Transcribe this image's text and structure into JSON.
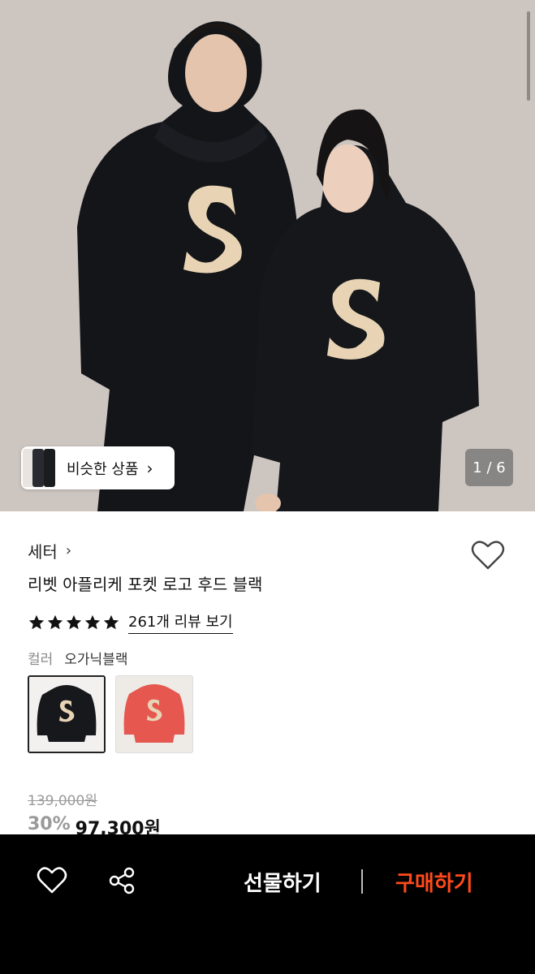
{
  "hero": {
    "similar_label": "비슷한 상품",
    "similar_chevron": "›",
    "counter": "1 / 6",
    "chevron_icon": "chevron-right-icon"
  },
  "product": {
    "brand": "세터",
    "brand_chevron": "›",
    "title": "리벳 아플리케 포켓 로고 후드 블랙",
    "rating_stars": 5,
    "review_link": "261개 리뷰 보기",
    "color_label": "컬러",
    "color_value": "오가닉블랙",
    "swatches": [
      "black",
      "coral"
    ],
    "original_price": "139,000원",
    "discount": "30%",
    "sale_price": "97,300원"
  },
  "bottom_bar": {
    "gift_label": "선물하기",
    "buy_label": "구매하기",
    "accent": "#ff4a1c"
  }
}
